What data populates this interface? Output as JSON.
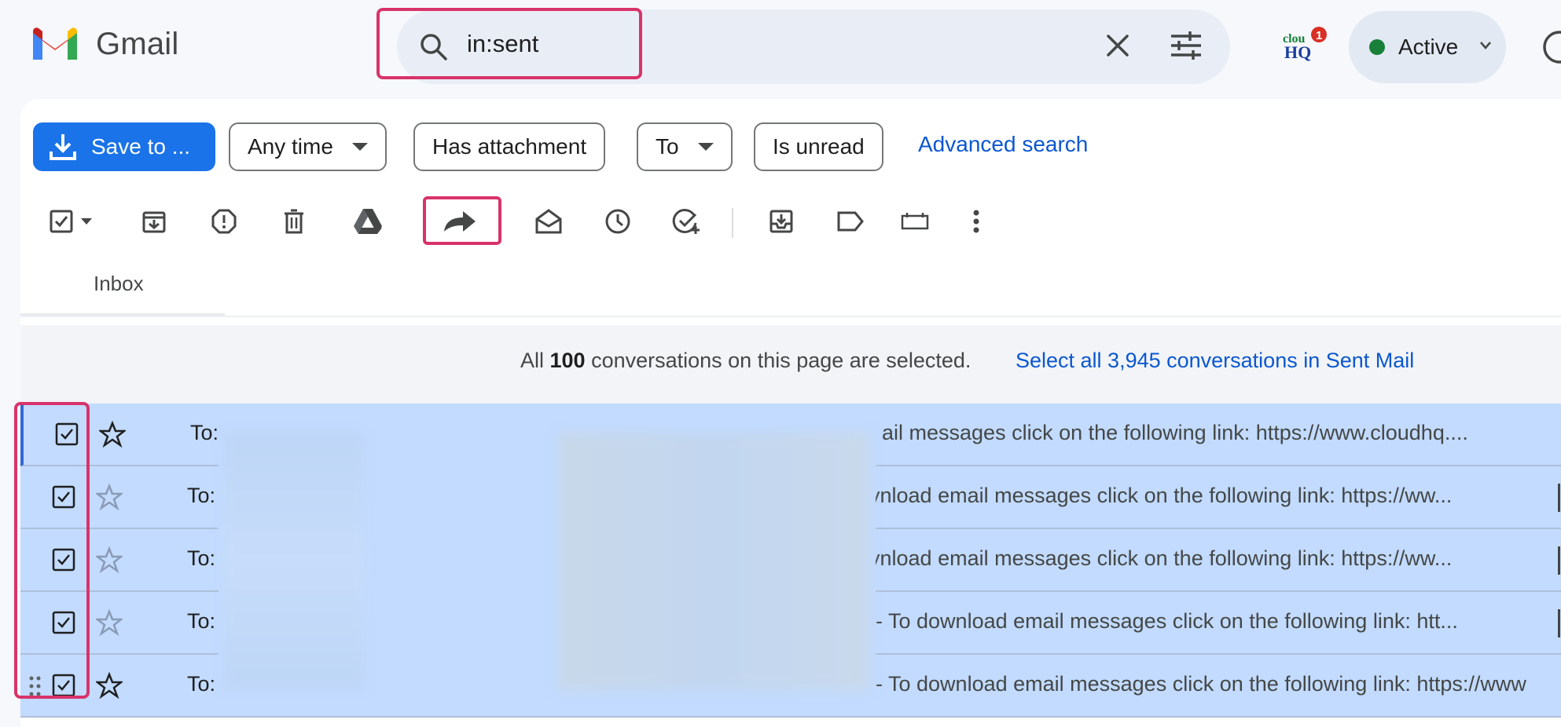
{
  "header": {
    "app_name": "Gmail",
    "search": {
      "query": "in:sent",
      "clear_icon": "close-icon",
      "options_icon": "tune-icon"
    },
    "cloudhq": {
      "brand_top": "clou",
      "brand_bottom": "HQ",
      "badge": "1"
    },
    "status": {
      "label": "Active",
      "color": "#188038"
    }
  },
  "filters": {
    "save_label": "Save to ...",
    "chips": [
      {
        "label": "Any time",
        "has_caret": true
      },
      {
        "label": "Has attachment",
        "has_caret": false
      },
      {
        "label": "To",
        "has_caret": true
      },
      {
        "label": "Is unread",
        "has_caret": false
      }
    ],
    "advanced_label": "Advanced search"
  },
  "toolbar": {
    "icons": [
      "select-all-checkbox-icon",
      "select-dropdown-icon",
      "archive-icon",
      "report-spam-icon",
      "delete-icon",
      "google-drive-icon",
      "forward-icon",
      "mark-read-icon",
      "snooze-icon",
      "add-to-tasks-icon",
      "move-to-inbox-icon",
      "label-icon",
      "ribbon-icon",
      "more-icon"
    ]
  },
  "tabs": {
    "primary": "Inbox"
  },
  "banner": {
    "prefix": "All ",
    "count": "100",
    "suffix": " conversations on this page are selected.",
    "link": "Select all 3,945 conversations in Sent Mail"
  },
  "emails": [
    {
      "to": "To:",
      "snippet": "ail messages click on the following link: https://www.cloudhq....",
      "starred": true,
      "selected": true
    },
    {
      "to": "To:",
      "snippet": "vnload email messages click on the following link: https://ww...",
      "starred": false,
      "selected": true
    },
    {
      "to": "To:",
      "snippet": "vnload email messages click on the following link: https://ww...",
      "starred": false,
      "selected": true
    },
    {
      "to": "To:",
      "snippet": "- To download email messages click on the following link: htt...",
      "starred": false,
      "selected": true
    },
    {
      "to": "To:",
      "snippet": "- To download email messages click on the following link: https://www",
      "starred": true,
      "selected": true
    }
  ],
  "colors": {
    "accent": "#1a73e8",
    "link": "#0b57d0",
    "selected_row": "#c2dbff",
    "highlight": "#d8336a"
  }
}
